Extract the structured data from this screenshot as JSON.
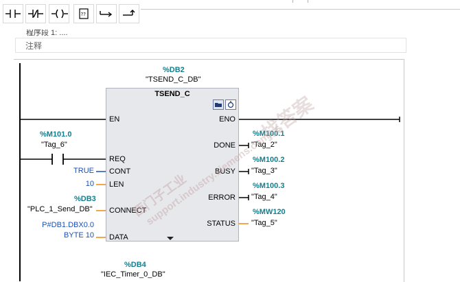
{
  "toolbar": {
    "buttons": [
      {
        "name": "no-contact-button",
        "icon": "normally-open-contact-icon"
      },
      {
        "name": "nc-contact-button",
        "icon": "normally-closed-contact-icon"
      },
      {
        "name": "coil-button",
        "icon": "coil-icon"
      },
      {
        "name": "empty-box-button",
        "icon": "empty-box-icon",
        "glyph": "??"
      },
      {
        "name": "open-branch-button",
        "icon": "open-branch-icon"
      },
      {
        "name": "close-branch-button",
        "icon": "close-branch-icon"
      }
    ]
  },
  "network": {
    "title": "程序段 1: ....",
    "comment": "注释"
  },
  "block": {
    "instance_db": "%DB2",
    "instance_name": "\"TSEND_C_DB\"",
    "type": "TSEND_C",
    "inputs": [
      "EN",
      "REQ",
      "CONT",
      "LEN",
      "CONNECT",
      "DATA"
    ],
    "outputs": [
      "ENO",
      "DONE",
      "BUSY",
      "ERROR",
      "STATUS"
    ]
  },
  "operands": {
    "req_addr": "%M101.0",
    "req_tag": "\"Tag_6\"",
    "cont_value": "TRUE",
    "len_value": "10",
    "connect_db": "%DB3",
    "connect_tag": "\"PLC_1_Send_DB\"",
    "data_pointer": "P#DB1.DBX0.0",
    "data_len": "BYTE 10",
    "done_addr": "%M100.1",
    "done_tag": "\"Tag_2\"",
    "busy_addr": "%M100.2",
    "busy_tag": "\"Tag_3\"",
    "error_addr": "%M100.3",
    "error_tag": "\"Tag_4\"",
    "status_addr": "%MW120",
    "status_tag": "\"Tag_5\""
  },
  "next_block": {
    "instance_db": "%DB4",
    "instance_name": "\"IEC_Timer_0_DB\""
  },
  "watermark": {
    "line1": "找答案",
    "line2": "西门子工业",
    "line3": "support.industry.siemens.com/cs"
  },
  "colors": {
    "address": "#127f8f",
    "constant": "#1a4fb5",
    "block_fill": "#e7e8ec",
    "data_line": "#f2a84a"
  }
}
